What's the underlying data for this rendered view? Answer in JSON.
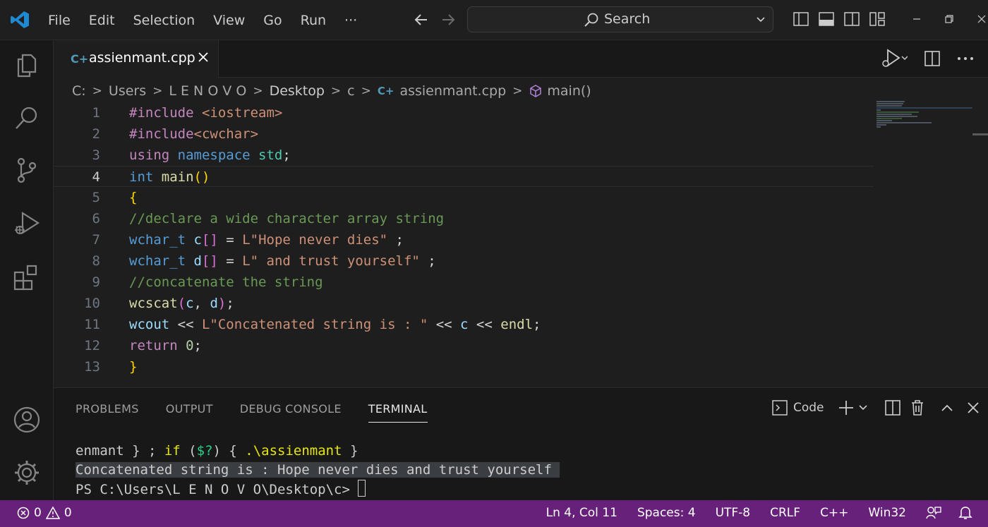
{
  "titlebar": {
    "menu": [
      "File",
      "Edit",
      "Selection",
      "View",
      "Go",
      "Run",
      "···"
    ],
    "search_label": "Search"
  },
  "tab": {
    "icon_text": "C+",
    "filename": "assienmant.cpp"
  },
  "breadcrumb": {
    "items": [
      "C:",
      "Users",
      "L E N O V O",
      "Desktop",
      "c"
    ],
    "file": "assienmant.cpp",
    "symbol": "main()"
  },
  "editor": {
    "current_line": 4,
    "lines": [
      {
        "n": "1",
        "tokens": [
          [
            "pp",
            "#include "
          ],
          [
            "str",
            "<iostream>"
          ]
        ]
      },
      {
        "n": "2",
        "tokens": [
          [
            "pp",
            "#include"
          ],
          [
            "str",
            "<cwchar>"
          ]
        ]
      },
      {
        "n": "3",
        "tokens": [
          [
            "pp",
            "using "
          ],
          [
            "kw",
            "namespace "
          ],
          [
            "ty",
            "std"
          ],
          [
            "op",
            ";"
          ]
        ]
      },
      {
        "n": "4",
        "tokens": [
          [
            "kw",
            "int "
          ],
          [
            "fn",
            "main"
          ],
          [
            "br1",
            "()"
          ]
        ]
      },
      {
        "n": "5",
        "tokens": [
          [
            "br1",
            "{"
          ]
        ]
      },
      {
        "n": "6",
        "tokens": [
          [
            "cm",
            "//declare a wide character array string"
          ]
        ]
      },
      {
        "n": "7",
        "tokens": [
          [
            "kw",
            "wchar_t "
          ],
          [
            "var",
            "c"
          ],
          [
            "br2",
            "[]"
          ],
          [
            "op",
            " = "
          ],
          [
            "str",
            "L\"Hope never dies\""
          ],
          [
            "op",
            " ;"
          ]
        ]
      },
      {
        "n": "8",
        "tokens": [
          [
            "kw",
            "wchar_t "
          ],
          [
            "var",
            "d"
          ],
          [
            "br2",
            "[]"
          ],
          [
            "op",
            " = "
          ],
          [
            "str",
            "L\" and trust yourself\""
          ],
          [
            "op",
            " ;"
          ]
        ]
      },
      {
        "n": "9",
        "tokens": [
          [
            "cm",
            "//concatenate the string"
          ]
        ]
      },
      {
        "n": "10",
        "tokens": [
          [
            "fn",
            "wcscat"
          ],
          [
            "br2",
            "("
          ],
          [
            "var",
            "c"
          ],
          [
            "op",
            ", "
          ],
          [
            "var",
            "d"
          ],
          [
            "br2",
            ")"
          ],
          [
            "op",
            ";"
          ]
        ]
      },
      {
        "n": "11",
        "tokens": [
          [
            "var",
            "wcout"
          ],
          [
            "op",
            " << "
          ],
          [
            "str",
            "L\"Concatenated string is : \""
          ],
          [
            "op",
            " << "
          ],
          [
            "var",
            "c"
          ],
          [
            "op",
            " << "
          ],
          [
            "fn",
            "endl"
          ],
          [
            "op",
            ";"
          ]
        ]
      },
      {
        "n": "12",
        "tokens": [
          [
            "cb",
            "return "
          ],
          [
            "num",
            "0"
          ],
          [
            "op",
            ";"
          ]
        ]
      },
      {
        "n": "13",
        "tokens": [
          [
            "br1",
            "}"
          ]
        ]
      }
    ]
  },
  "panel": {
    "tabs": [
      "PROBLEMS",
      "OUTPUT",
      "DEBUG CONSOLE",
      "TERMINAL"
    ],
    "active_tab": "TERMINAL",
    "terminal_name": "Code",
    "terminal": {
      "line1_a": "enmant } ; ",
      "line1_b": "if",
      "line1_c": " (",
      "line1_d": "$?",
      "line1_e": ") { ",
      "line1_f": ".\\assienmant",
      "line1_g": " }",
      "line2": "Concatenated string is : Hope never dies and trust yourself ",
      "prompt": "PS C:\\Users\\L E N O V O\\Desktop\\c> "
    }
  },
  "status": {
    "errors": "0",
    "warnings": "0",
    "position": "Ln 4, Col 11",
    "spaces": "Spaces: 4",
    "encoding": "UTF-8",
    "eol": "CRLF",
    "language": "C++",
    "platform": "Win32"
  },
  "colors": {
    "accent": "#68217a",
    "editor_bg": "#1e1e1e",
    "sidebar_bg": "#181818"
  }
}
